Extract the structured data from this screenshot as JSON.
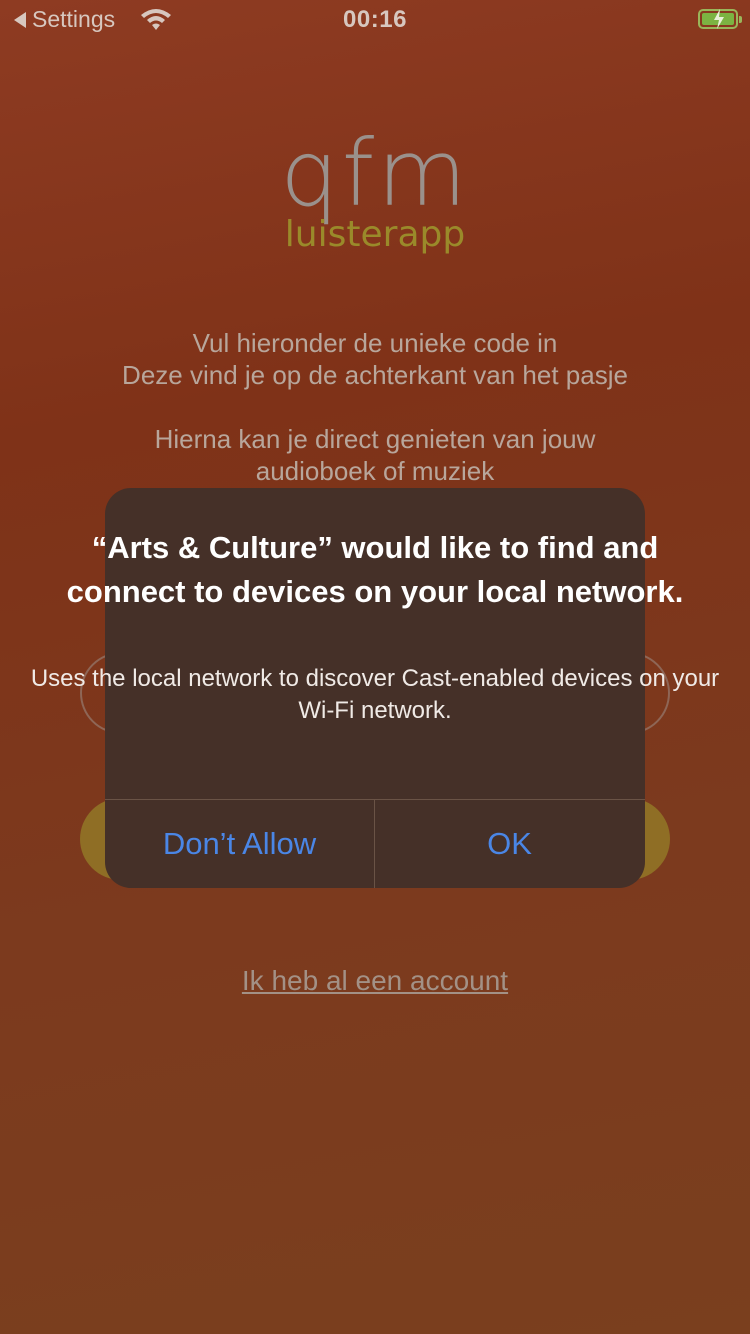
{
  "status_bar": {
    "back_label": "Settings",
    "time": "00:16",
    "battery_state": "charging",
    "battery_color": "#7cb342"
  },
  "logo": {
    "name": "qfm",
    "tagline": "luisterapp"
  },
  "intro": {
    "line1": "Vul hieronder de unieke code in",
    "line2": "Deze vind je op de achterkant van het pasje",
    "line3": "Hierna kan je direct genieten van jouw",
    "line4": "audioboek of muziek"
  },
  "code_field": {
    "value": ""
  },
  "account_link": "Ik heb al een account",
  "alert": {
    "title": "“Arts & Culture” would like to find and connect to devices on your local network.",
    "message": "Uses the local network to discover Cast-enabled devices on your Wi-Fi network.",
    "deny_label": "Don’t Allow",
    "ok_label": "OK",
    "button_color": "#4a86e6"
  },
  "icons": {
    "back": "back-arrow-icon",
    "wifi": "wifi-icon",
    "battery": "battery-charging-icon"
  }
}
